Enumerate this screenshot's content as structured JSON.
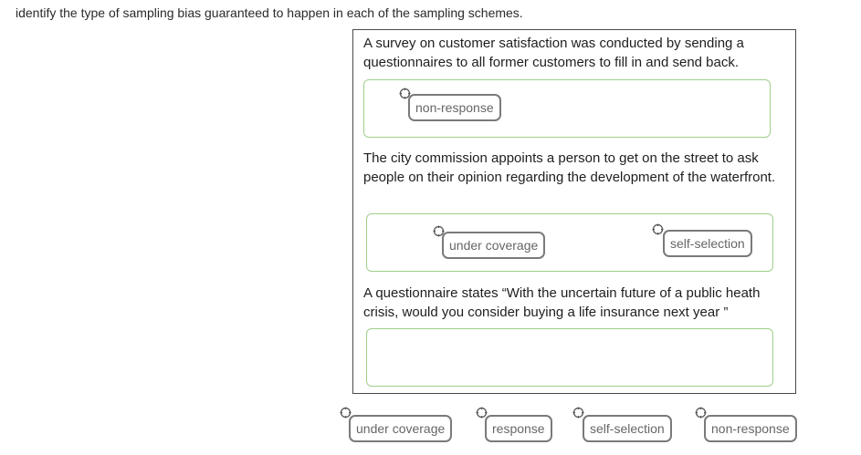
{
  "instruction": "identify the type of sampling bias guaranteed to happen in each of the sampling schemes.",
  "questions": [
    {
      "text": "A survey on customer satisfaction was conducted by sending a questionnaires to all former customers to fill in and send back.",
      "placed_chips": [
        "non-response"
      ]
    },
    {
      "text": "The city commission appoints a person to get on the street to ask people on their opinion regarding the development of the waterfront.",
      "placed_chips": [
        "under coverage",
        "self-selection"
      ]
    },
    {
      "text": "A questionnaire states “With the uncertain future of a public heath crisis, would you consider buying a life insurance next year ”",
      "placed_chips": []
    }
  ],
  "chip_bank": [
    "under coverage",
    "response",
    "self-selection",
    "non-response"
  ],
  "colors": {
    "dropzone_border": "#9fcf8a",
    "chip_border": "#7a7a7a",
    "panel_border": "#4a4a4a"
  },
  "icons": {
    "drag_handle": "move-handle-icon"
  }
}
